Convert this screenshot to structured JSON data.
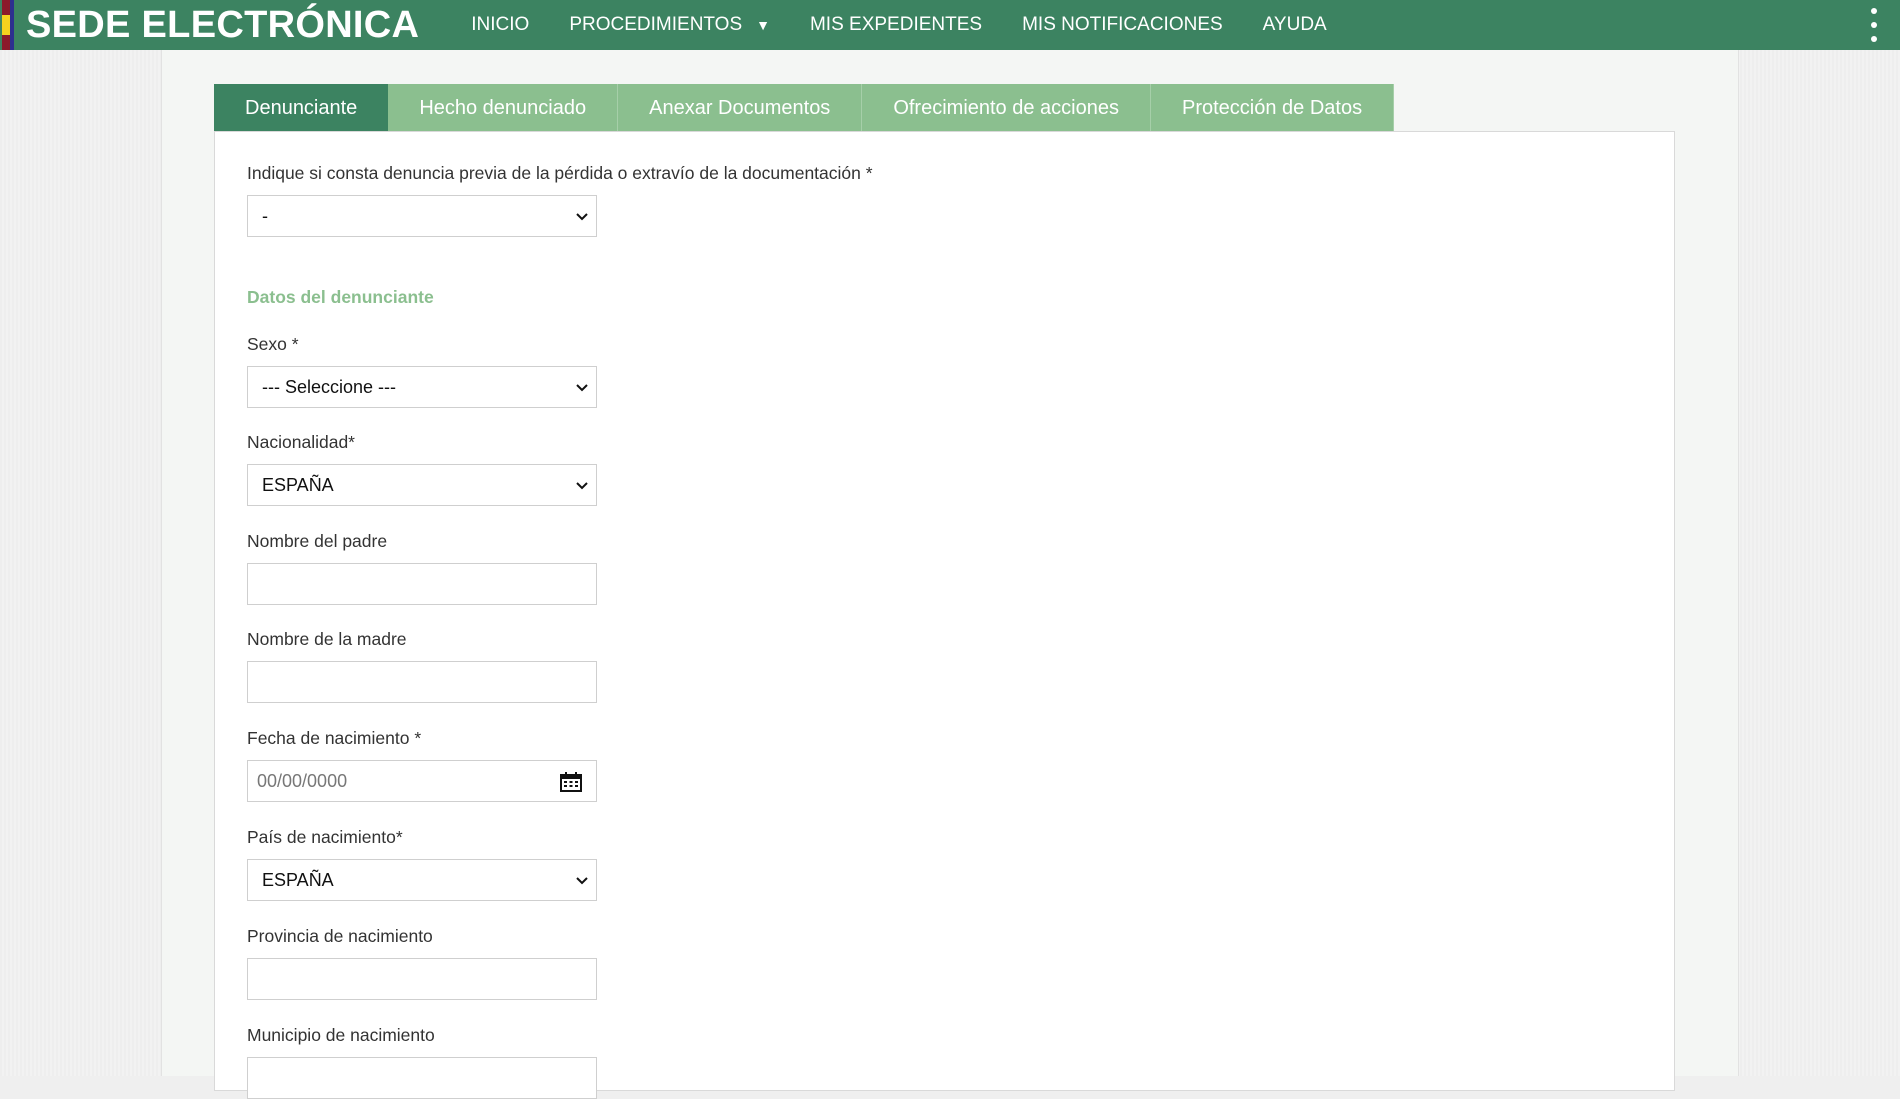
{
  "header": {
    "brand": "SEDE ELECTRÓNICA",
    "nav": [
      {
        "label": "INICIO"
      },
      {
        "label": "PROCEDIMIENTOS"
      },
      {
        "label": "MIS EXPEDIENTES"
      },
      {
        "label": "MIS NOTIFICACIONES"
      },
      {
        "label": "AYUDA"
      }
    ],
    "procedimientos_caret": "▼",
    "menu_icon": "more-vertical-icon"
  },
  "tabs": [
    {
      "label": "Denunciante",
      "active": true
    },
    {
      "label": "Hecho denunciado",
      "active": false
    },
    {
      "label": "Anexar Documentos",
      "active": false
    },
    {
      "label": "Ofrecimiento de acciones",
      "active": false
    },
    {
      "label": "Protección de Datos",
      "active": false
    }
  ],
  "form": {
    "denuncia_previa": {
      "label": "Indique si consta denuncia previa de la pérdida o extravío de la documentación *",
      "value": "-"
    },
    "section_title": "Datos del denunciante",
    "sexo": {
      "label": "Sexo *",
      "value": "--- Seleccione ---"
    },
    "nacionalidad": {
      "label": "Nacionalidad*",
      "value": "ESPAÑA"
    },
    "nombre_padre": {
      "label": "Nombre del padre",
      "value": ""
    },
    "nombre_madre": {
      "label": "Nombre de la madre",
      "value": ""
    },
    "fecha_nacimiento": {
      "label": "Fecha de nacimiento *",
      "placeholder": "00/00/0000"
    },
    "pais_nacimiento": {
      "label": "País de nacimiento*",
      "value": "ESPAÑA"
    },
    "provincia_nacimiento": {
      "label": "Provincia de nacimiento",
      "value": ""
    },
    "municipio_nacimiento": {
      "label": "Municipio de nacimiento",
      "value": ""
    }
  },
  "colors": {
    "header_green": "#3c8361",
    "tab_inactive": "#8bbf8f",
    "section_title": "#8bbf8f"
  }
}
